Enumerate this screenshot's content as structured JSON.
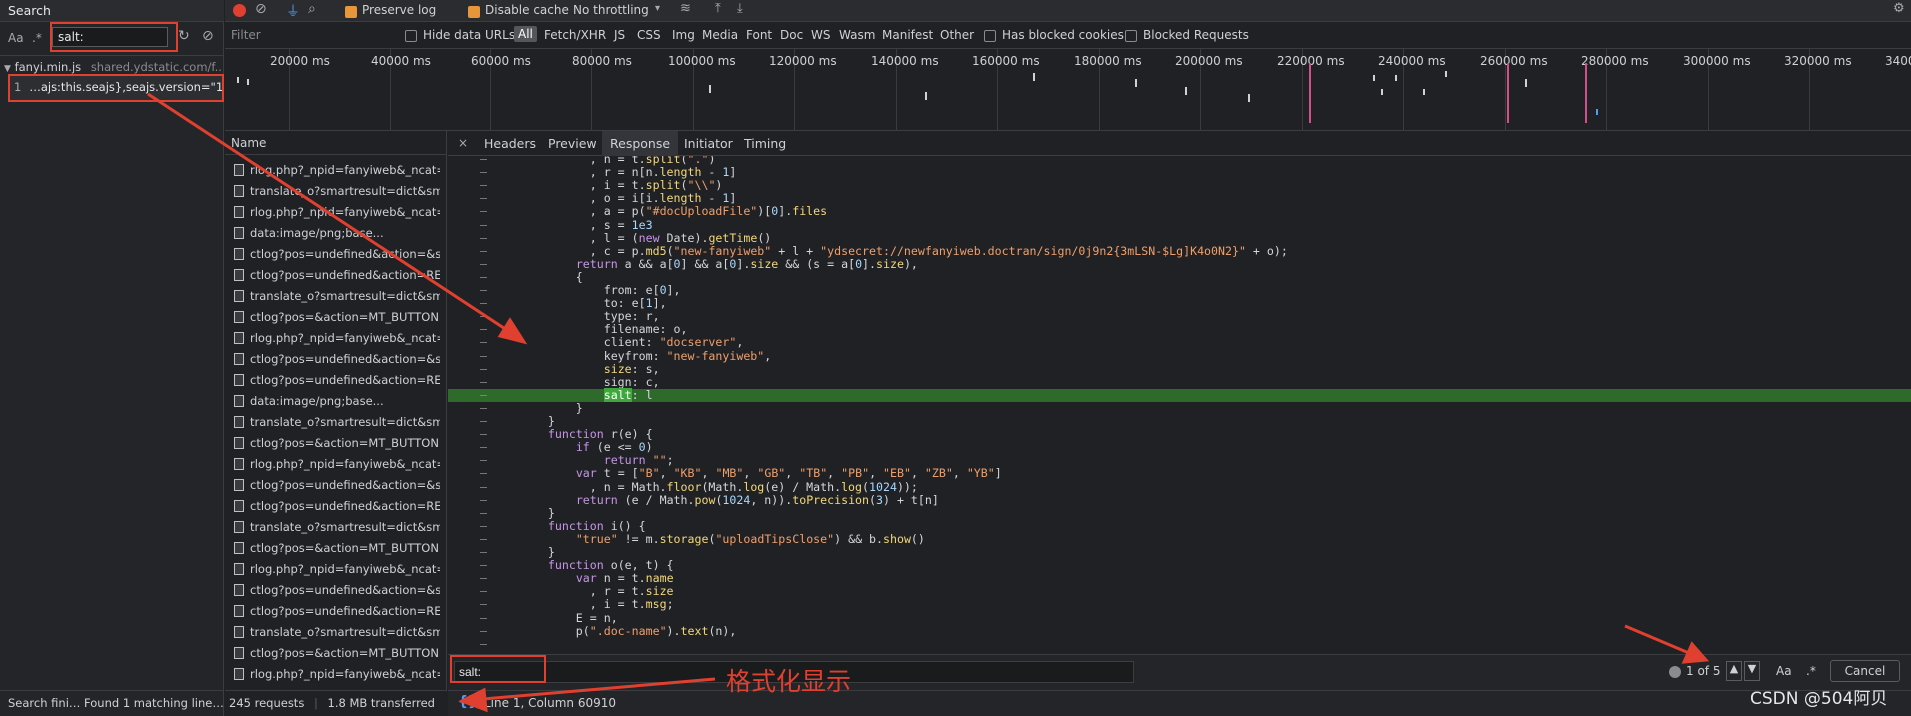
{
  "search_panel": {
    "tab_label": "Search",
    "aa_label": "Aa",
    "regex_label": ".*",
    "query": "salt:",
    "result_file": "fanyi.min.js",
    "result_origin": "shared.ydstatic.com/f...",
    "result_line_num": "1",
    "result_line_text": "…ajs:this.seajs},seajs.version=\"1…",
    "status": "Search fini… Found 1 matching line…"
  },
  "network_toolbar": {
    "preserve_log": "Preserve log",
    "disable_cache": "Disable cache",
    "throttling": "No throttling"
  },
  "filter_bar": {
    "placeholder": "Filter",
    "hide_data_urls": "Hide data URLs",
    "types": [
      "All",
      "Fetch/XHR",
      "JS",
      "CSS",
      "Img",
      "Media",
      "Font",
      "Doc",
      "WS",
      "Wasm",
      "Manifest",
      "Other"
    ],
    "has_blocked_cookies": "Has blocked cookies",
    "blocked_requests": "Blocked Requests"
  },
  "timeline": {
    "ticks": [
      "20000 ms",
      "40000 ms",
      "60000 ms",
      "80000 ms",
      "100000 ms",
      "120000 ms",
      "140000 ms",
      "160000 ms",
      "180000 ms",
      "200000 ms",
      "220000 ms",
      "240000 ms",
      "260000 ms",
      "280000 ms",
      "300000 ms",
      "320000 ms",
      "3400"
    ]
  },
  "request_list": {
    "header": "Name",
    "rows": [
      "rlog.php?_npid=fanyiweb&_ncat=...",
      "translate_o?smartresult=dict&sm...",
      "rlog.php?_npid=fanyiweb&_ncat=...",
      "data:image/png;base...",
      "ctlog?pos=undefined&action=&se...",
      "ctlog?pos=undefined&action=RE...",
      "translate_o?smartresult=dict&sm...",
      "ctlog?pos=&action=MT_BUTTON...",
      "rlog.php?_npid=fanyiweb&_ncat=...",
      "ctlog?pos=undefined&action=&se...",
      "ctlog?pos=undefined&action=RE...",
      "data:image/png;base...",
      "translate_o?smartresult=dict&sm...",
      "ctlog?pos=&action=MT_BUTTON...",
      "rlog.php?_npid=fanyiweb&_ncat=...",
      "ctlog?pos=undefined&action=&se...",
      "ctlog?pos=undefined&action=RE...",
      "translate_o?smartresult=dict&sm...",
      "ctlog?pos=&action=MT_BUTTON...",
      "rlog.php?_npid=fanyiweb&_ncat=...",
      "ctlog?pos=undefined&action=&se...",
      "ctlog?pos=undefined&action=RE...",
      "translate_o?smartresult=dict&sm...",
      "ctlog?pos=&action=MT_BUTTON...",
      "rlog.php?_npid=fanyiweb&_ncat=..."
    ],
    "requests": "245 requests",
    "transferred": "1.8 MB transferred"
  },
  "response_tabs": [
    "Headers",
    "Preview",
    "Response",
    "Initiator",
    "Timing"
  ],
  "code_lines": [
    "            , n = t.split(\".\")",
    "            , r = n[n.length - 1]",
    "            , i = t.split(\"\\\\\")",
    "            , o = i[i.length - 1]",
    "            , a = p(\"#docUploadFile\")[0].files",
    "            , s = 1e3",
    "            , l = (new Date).getTime()",
    "            , c = p.md5(\"new-fanyiweb\" + l + \"ydsecret://newfanyiweb.doctran/sign/0j9n2{3mLSN-$Lg]K4o0N2}\" + o);",
    "          return a && a[0] && a[0].size && (s = a[0].size),",
    "          {",
    "              from: e[0],",
    "              to: e[1],",
    "              type: r,",
    "              filename: o,",
    "              client: \"docserver\",",
    "              keyfrom: \"new-fanyiweb\",",
    "              size: s,",
    "              sign: c,",
    "              salt: l",
    "          }",
    "      }",
    "      function r(e) {",
    "          if (e <= 0)",
    "              return \"\";",
    "          var t = [\"B\", \"KB\", \"MB\", \"GB\", \"TB\", \"PB\", \"EB\", \"ZB\", \"YB\"]",
    "            , n = Math.floor(Math.log(e) / Math.log(1024));",
    "          return (e / Math.pow(1024, n)).toPrecision(3) + t[n]",
    "      }",
    "      function i() {",
    "          \"true\" != m.storage(\"uploadTipsClose\") && b.show()",
    "      }",
    "      function o(e, t) {",
    "          var n = t.name",
    "            , r = t.size",
    "            , i = t.msg;",
    "          E = n,",
    "          p(\".doc-name\").text(n),",
    "      "
  ],
  "find_bar": {
    "query": "salt:",
    "count": "1 of 5",
    "aa": "Aa",
    "regex": ".*",
    "cancel": "Cancel"
  },
  "cursor_bar": {
    "format_icon": "{}",
    "position": "Line 1, Column 60910"
  },
  "annotation": "格式化显示",
  "watermark": "CSDN @504阿贝",
  "colors": {
    "accent_red": "#e0402f",
    "highlight_green": "#2e6b2b",
    "record_red": "#e0402f"
  }
}
